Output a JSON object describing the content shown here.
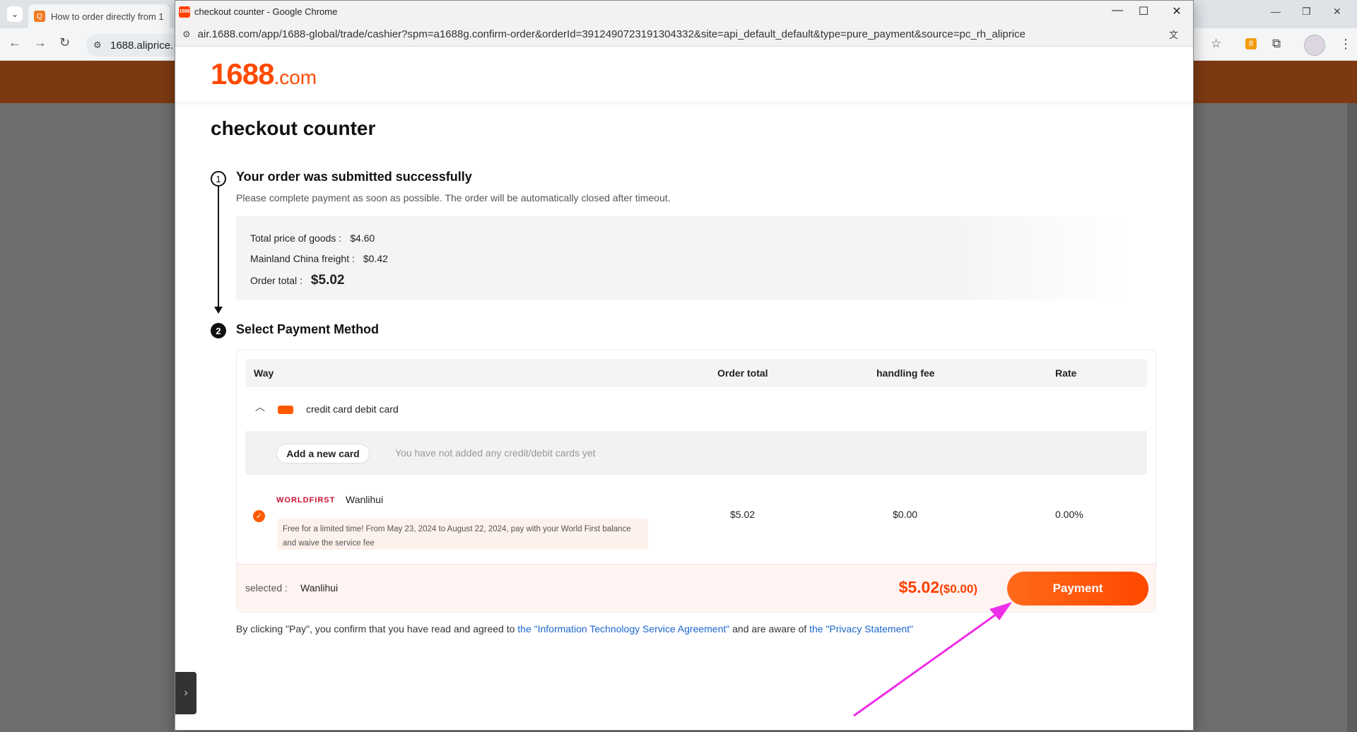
{
  "background_browser": {
    "tab_title": "How to order directly from 1",
    "tab_favicon": "Q",
    "omnibox_url": "1688.aliprice.",
    "extension_badge": "8"
  },
  "popup": {
    "window_title": "checkout counter - Google Chrome",
    "favicon_text": "1688",
    "url": "air.1688.com/app/1688-global/trade/cashier?spm=a1688g.confirm-order&orderId=3912490723191304332&site=api_default_default&type=pure_payment&source=pc_rh_aliprice",
    "logo_number": "1688",
    "logo_domain": ".com",
    "page_title": "checkout counter",
    "step1": {
      "number": "1",
      "title": "Your order was submitted successfully",
      "subtitle": "Please complete payment as soon as possible. The order will be automatically closed after timeout.",
      "goods_label": "Total price of goods :",
      "goods_value": "$4.60",
      "freight_label": "Mainland China freight :",
      "freight_value": "$0.42",
      "total_label": "Order total :",
      "total_value": "$5.02"
    },
    "step2": {
      "number": "2",
      "title": "Select Payment Method",
      "columns": {
        "way": "Way",
        "order_total": "Order total",
        "handling_fee": "handling fee",
        "rate": "Rate"
      },
      "method_label": "credit card debit card",
      "add_card_button": "Add a new card",
      "add_card_hint": "You have not added any credit/debit cards yet",
      "worldfirst": {
        "logo_text": "WORLDFIRST",
        "name": "Wanlihui",
        "promo": "Free for a limited time! From May 23, 2024 to August 22, 2024, pay with your World First balance and waive the service fee",
        "order_total": "$5.02",
        "handling_fee": "$0.00",
        "rate": "0.00%"
      },
      "selected_label": "selected :",
      "selected_value": "Wanlihui",
      "final_price": "$5.02",
      "final_fee": "($0.00)",
      "payment_button": "Payment"
    },
    "agreement": {
      "prefix": "By clicking \"Pay\", you confirm that you have read and agreed to",
      "link1": "the \"Information Technology Service Agreement\"",
      "middle": "and are aware of",
      "link2": "the \"Privacy Statement\""
    }
  },
  "colors": {
    "brand_orange": "#ff4a00",
    "annotation_arrow": "#ee2ee8",
    "link_blue": "#1a66cc"
  }
}
